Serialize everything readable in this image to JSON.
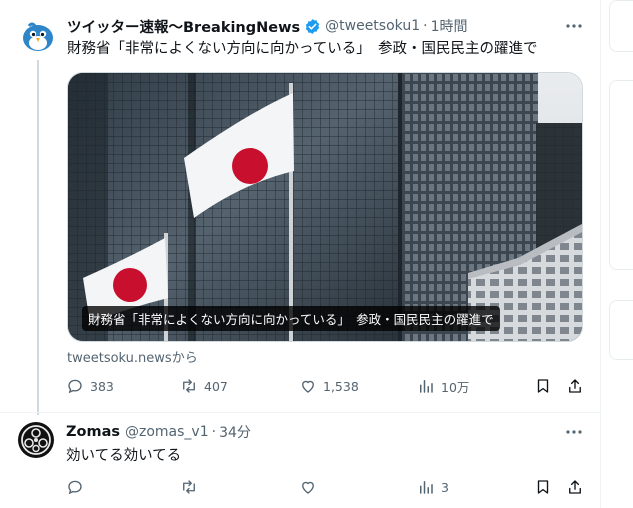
{
  "tweet1": {
    "display_name": "ツイッター速報〜BreakingNews",
    "handle": "@tweetsoku1",
    "separator": "·",
    "time": "1時間",
    "text": "財務省「非常によくない方向に向かっている」　参政・国民民主の躍進で",
    "card": {
      "caption": "財務省「非常によくない方向に向かっている」　参政・国民民主の躍進で",
      "source": "tweetsoku.newsから"
    },
    "actions": {
      "replies": "383",
      "retweets": "407",
      "likes": "1,538",
      "views": "10万"
    }
  },
  "tweet2": {
    "display_name": "Zomas",
    "handle": "@zomas_v1",
    "separator": "·",
    "time": "34分",
    "text": "効いてる効いてる",
    "actions": {
      "replies": "",
      "retweets": "",
      "likes": "",
      "views": "3"
    }
  },
  "colors": {
    "text": "#0f1419",
    "secondary": "#536471",
    "verified": "#1d9bf0",
    "divider": "#eff3f4"
  },
  "icons": [
    "bird-avatar",
    "verified-badge-icon",
    "more-icon",
    "reply-icon",
    "retweet-icon",
    "like-icon",
    "views-icon",
    "bookmark-icon",
    "share-icon",
    "crest-avatar"
  ]
}
